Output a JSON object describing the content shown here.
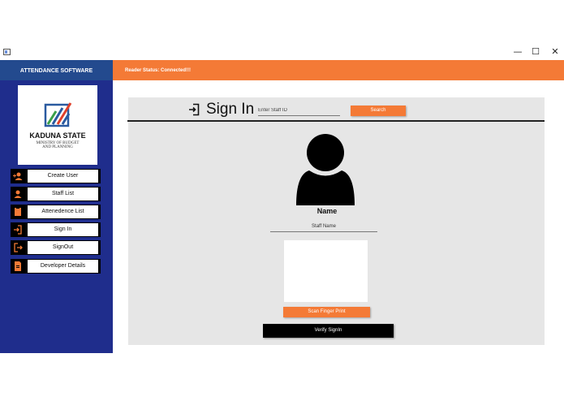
{
  "window": {
    "minimize": "—",
    "maximize": "☐",
    "close": "✕"
  },
  "sidebar": {
    "header": "ATTENDANCE SOFTWARE",
    "logo": {
      "title": "KADUNA STATE",
      "subtitle_line1": "MINISTRY OF BUDGET",
      "subtitle_line2": "AND PLANNING"
    },
    "items": [
      {
        "label": "Create User",
        "icon": "add-user-icon"
      },
      {
        "label": "Staff List",
        "icon": "user-icon"
      },
      {
        "label": "Attenedence List",
        "icon": "clipboard-icon"
      },
      {
        "label": "Sign In",
        "icon": "sign-in-icon"
      },
      {
        "label": "SignOut",
        "icon": "sign-out-icon"
      },
      {
        "label": "Developer Details",
        "icon": "document-icon"
      }
    ]
  },
  "topbar": {
    "status": "Reader Status: Connected!!!"
  },
  "signin": {
    "title": "Sign In",
    "staff_id_placeholder": "Enter Staff ID",
    "search_label": "Search",
    "name_label": "Name",
    "staff_name_placeholder": "Staff Name",
    "scan_label": "Scan Finger Print",
    "verify_label": "Verify SignIn"
  },
  "colors": {
    "accent": "#f47a36",
    "sidebar": "#1f2d8c",
    "sidebar_header": "#234a8e",
    "panel": "#e6e6e6"
  }
}
